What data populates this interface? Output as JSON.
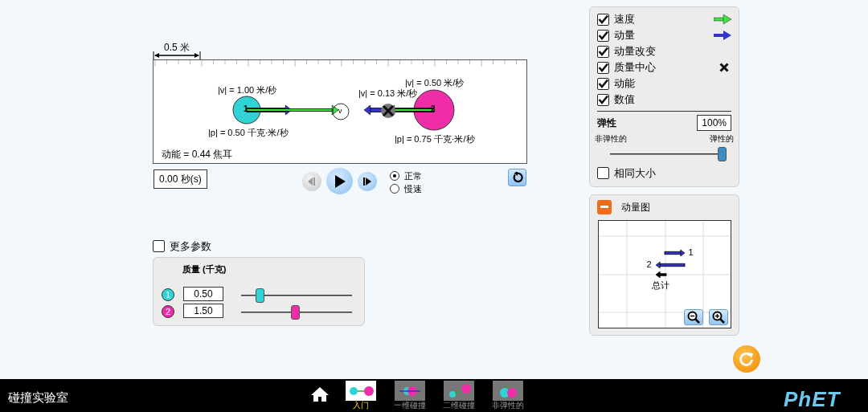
{
  "ruler": {
    "label": "0.5 米"
  },
  "balls": [
    {
      "number": "1",
      "color": "#2fd3d3",
      "handle_label": "v",
      "velocity_label": "|v| = 1.00 米/秒",
      "momentum_label": "|p| = 0.50 千克·米/秒"
    },
    {
      "number": "2",
      "color": "#ee2da7",
      "velocity_label": "|v| = 0.50 米/秒",
      "momentum_label": "|p| = 0.75 千克·米/秒"
    }
  ],
  "center_of_mass": {
    "velocity_label": "|v| = 0.13 米/秒"
  },
  "kinetic_energy": "动能 = 0.44 焦耳",
  "time": "0.00 秒(s)",
  "speed_options": [
    {
      "label": "正常",
      "selected": true
    },
    {
      "label": "慢速",
      "selected": false
    }
  ],
  "options": [
    {
      "label": "速度",
      "checked": true,
      "kind": "velocity"
    },
    {
      "label": "动量",
      "checked": true,
      "kind": "momentum"
    },
    {
      "label": "动量改变",
      "checked": true,
      "kind": "plain"
    },
    {
      "label": "质量中心",
      "checked": true,
      "kind": "center"
    },
    {
      "label": "动能",
      "checked": true,
      "kind": "plain"
    },
    {
      "label": "数值",
      "checked": true,
      "kind": "plain"
    }
  ],
  "elasticity": {
    "label": "弹性",
    "value": "100%",
    "min_label": "非弹性的",
    "max_label": "弹性的",
    "level": 1
  },
  "same_size": {
    "label": "相同大小",
    "checked": false
  },
  "momentum_diagram": {
    "title": "动量图",
    "expanded": true,
    "labels": [
      "1",
      "2",
      "总计"
    ]
  },
  "more_data": {
    "label": "更多参数",
    "checked": false
  },
  "mass_panel": {
    "title": "质量 (千克)",
    "balls": [
      {
        "number": "1",
        "color": "#2fd3d3",
        "value": "0.50",
        "level": 0.14
      },
      {
        "number": "2",
        "color": "#ee2da7",
        "value": "1.50",
        "level": 0.49
      }
    ]
  },
  "app_title": "碰撞实验室",
  "screens": [
    {
      "label": "入门",
      "selected": true
    },
    {
      "label": "一维碰撞",
      "selected": false
    },
    {
      "label": "二维碰撞",
      "selected": false
    },
    {
      "label": "非弹性的",
      "selected": false
    }
  ],
  "logo": "PhET"
}
